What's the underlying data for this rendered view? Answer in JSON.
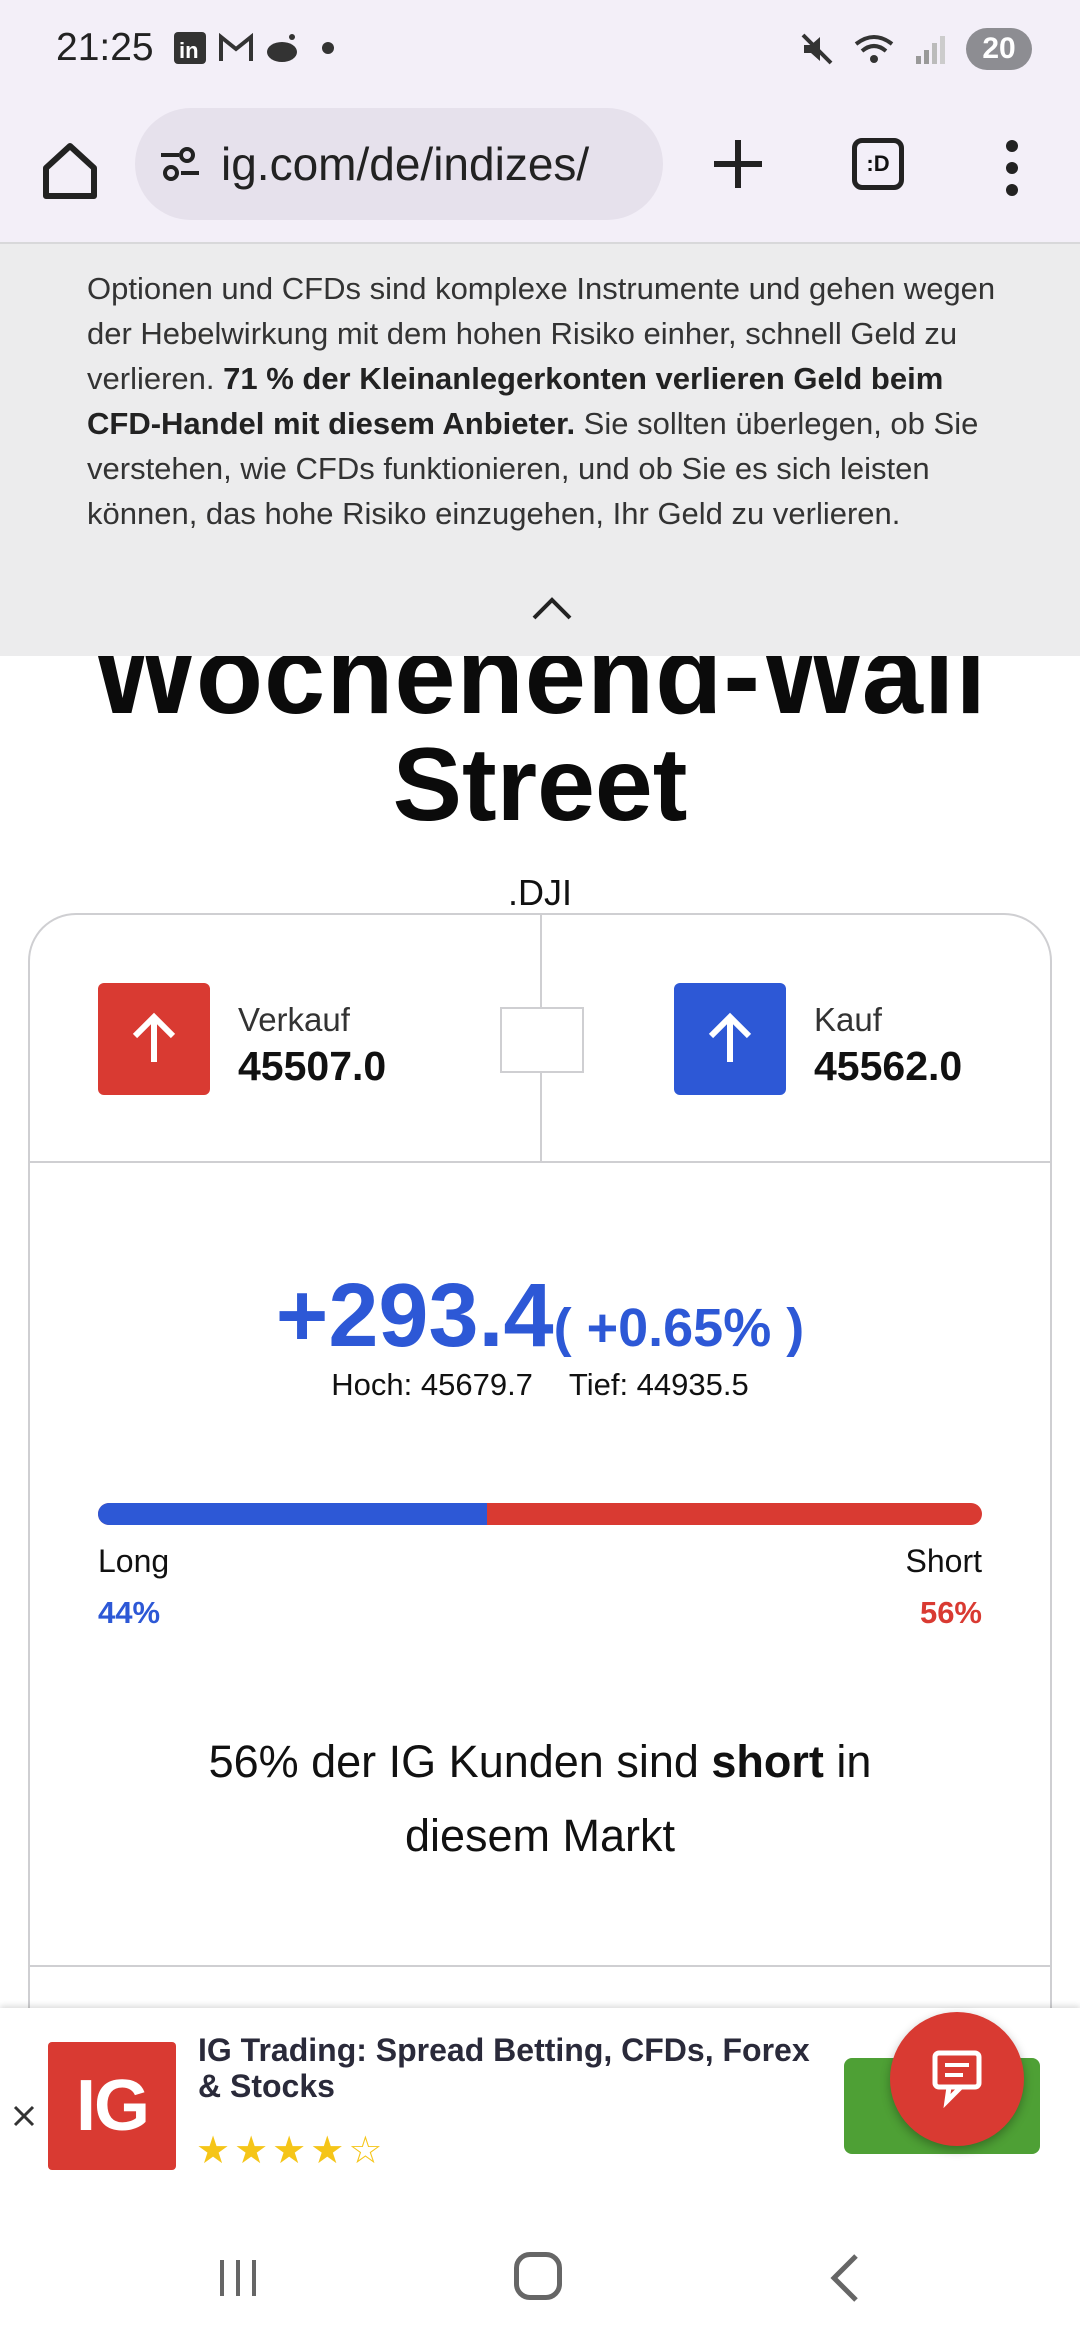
{
  "status_bar": {
    "time": "21:25",
    "notification_icons": [
      "linkedin-icon",
      "gmail-icon",
      "reddit-icon",
      "dot-icon"
    ],
    "battery": "20"
  },
  "browser": {
    "url": "ig.com/de/indizes/",
    "tabs_label": ":D"
  },
  "risk_warning": {
    "text_before": "Optionen und CFDs sind komplexe Instrumente und gehen wegen der Hebelwirkung mit dem hohen Risiko einher, schnell Geld zu verlieren. ",
    "text_bold": "71 % der Kleinanlegerkonten verlieren Geld beim CFD-Handel mit diesem Anbieter.",
    "text_after": " Sie sollten überlegen, ob Sie verstehen, wie CFDs funktionieren, und ob Sie es sich leisten können, das hohe Risiko einzugehen, Ihr Geld zu verlieren."
  },
  "page": {
    "headline_cut": "Wochenend-Wall",
    "headline": "Street",
    "ticker": ".DJI"
  },
  "quote": {
    "sell_label": "Verkauf",
    "sell_price": "45507.0",
    "buy_label": "Kauf",
    "buy_price": "45562.0",
    "change": "+293.4",
    "change_pct": "( +0.65% )",
    "high_label": "Hoch: 45679.7",
    "low_label": "Tief: 44935.5",
    "colors": {
      "up": "#2d58d6",
      "down": "#d93a32"
    }
  },
  "sentiment": {
    "long_label": "Long",
    "short_label": "Short",
    "long_pct": "44%",
    "short_pct": "56%",
    "long_fraction": 0.44,
    "text_before": "56% der IG Kunden sind ",
    "text_bold": "short",
    "text_after": " in diesem Markt"
  },
  "app_banner": {
    "logo": "IG",
    "title": "IG Trading: Spread Betting, CFDs, Forex & Stocks",
    "rating": 4.5,
    "button": "O"
  }
}
